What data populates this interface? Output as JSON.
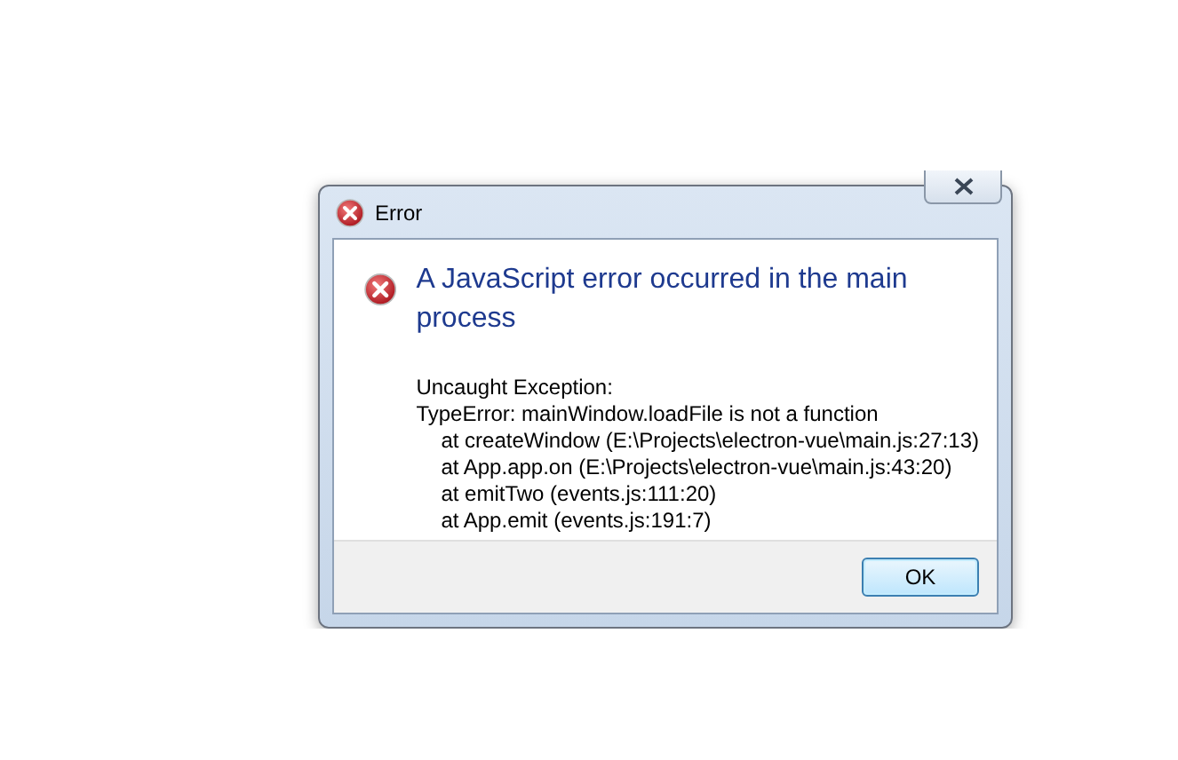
{
  "window": {
    "title": "Error"
  },
  "heading": "A JavaScript error occurred in the main process",
  "message": [
    "Uncaught Exception:",
    "TypeError: mainWindow.loadFile is not a function"
  ],
  "stack": [
    "at createWindow (E:\\Projects\\electron-vue\\main.js:27:13)",
    "at App.app.on (E:\\Projects\\electron-vue\\main.js:43:20)",
    "at emitTwo (events.js:111:20)",
    "at App.emit (events.js:191:7)"
  ],
  "buttons": [
    "OK"
  ]
}
